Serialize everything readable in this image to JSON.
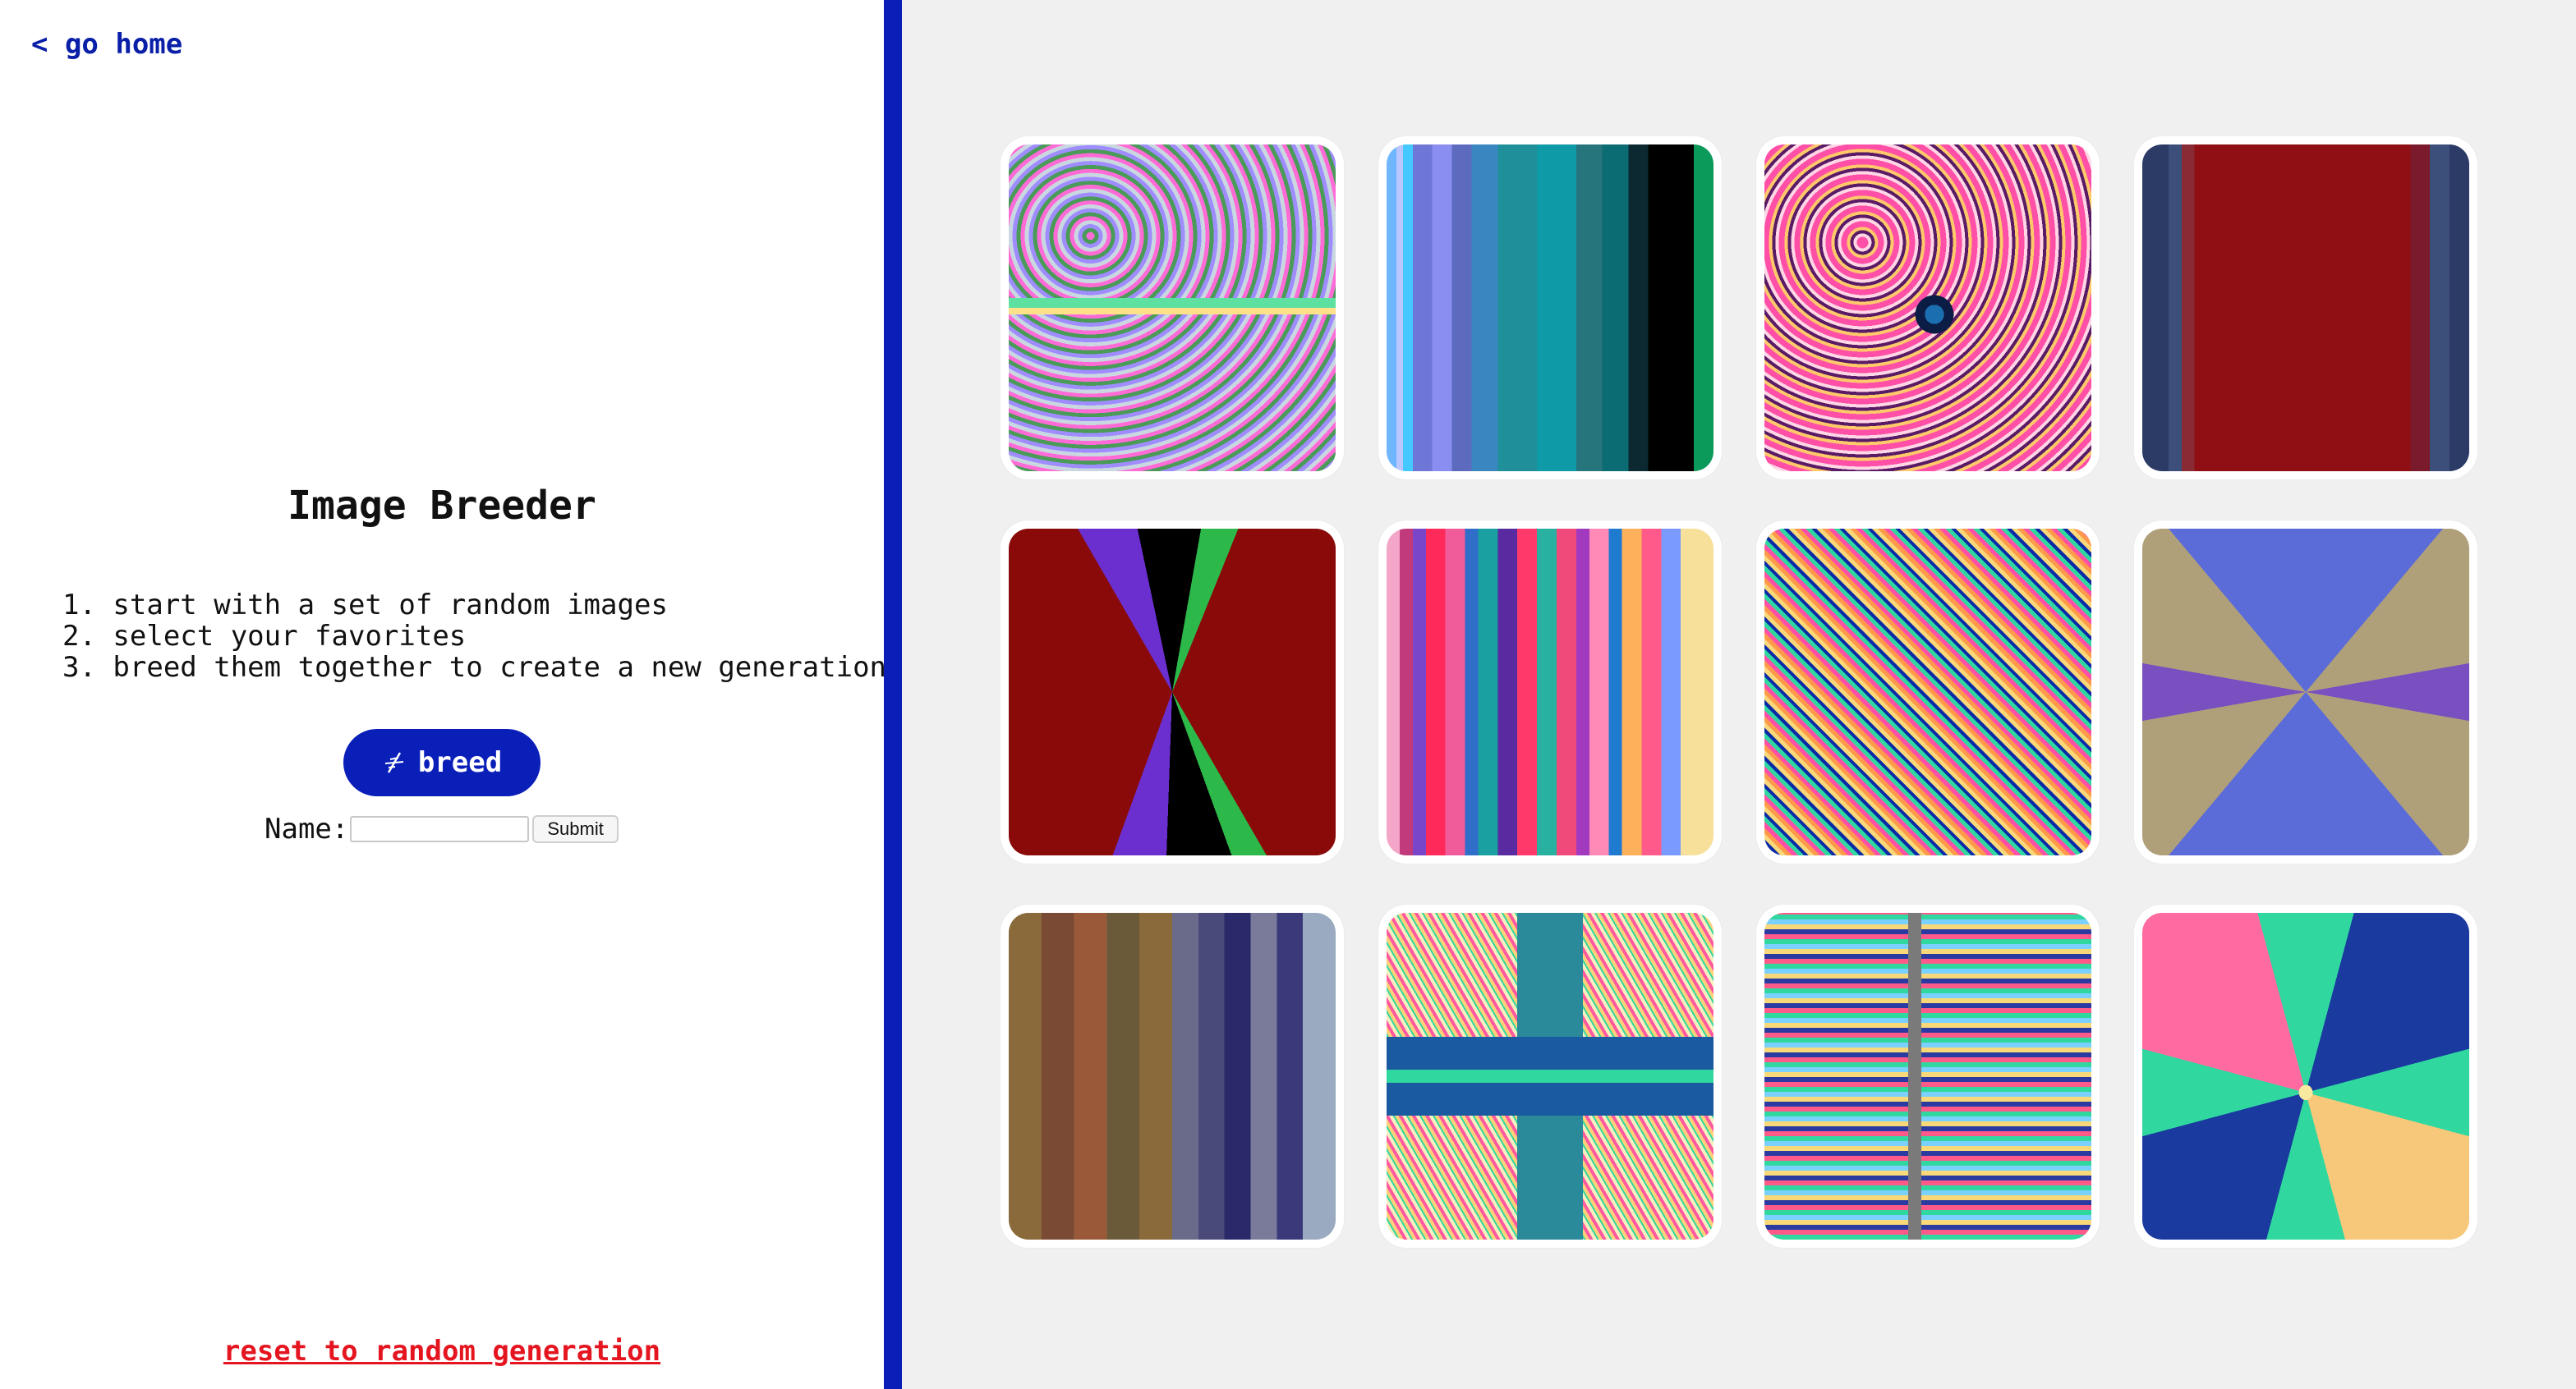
{
  "nav": {
    "go_home": "< go home"
  },
  "header": {
    "title": "Image Breeder"
  },
  "steps": [
    "1. start with a set of random images",
    "2. select your favorites",
    "3. breed them together to create a new generation"
  ],
  "breed": {
    "label": "breed",
    "icon": "dna-icon"
  },
  "name_form": {
    "label": "Name:",
    "value": "",
    "submit_label": "Submit"
  },
  "reset": {
    "label": "reset to random generation"
  },
  "colors": {
    "accent": "#0a1fb8",
    "danger": "#e51520",
    "panel_bg": "#f0f0f0"
  },
  "gallery": {
    "images": [
      {
        "style": "psychedelic-symmetric"
      },
      {
        "style": "cyan-vertical-stripes"
      },
      {
        "style": "pink-swirls"
      },
      {
        "style": "red-center-stripes"
      },
      {
        "style": "red-vanishing-point"
      },
      {
        "style": "multicolor-stripes"
      },
      {
        "style": "kaleidoscope-noise"
      },
      {
        "style": "blue-tan-star"
      },
      {
        "style": "brown-blue-stripes"
      },
      {
        "style": "yellow-pink-cross"
      },
      {
        "style": "pixel-grid"
      },
      {
        "style": "green-star-swirl"
      }
    ]
  }
}
